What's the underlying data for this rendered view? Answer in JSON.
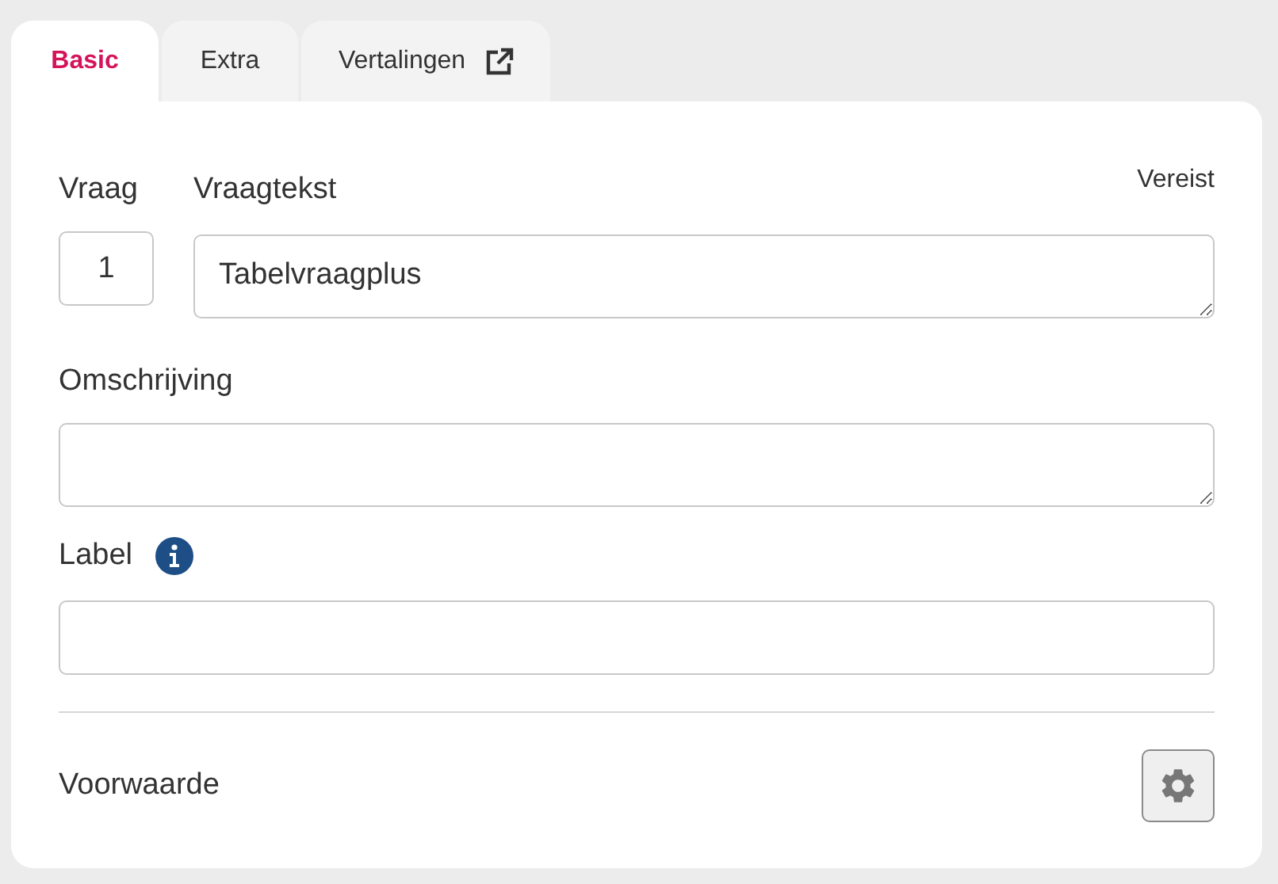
{
  "tabs": [
    {
      "label": "Basic",
      "selected": true,
      "external": false
    },
    {
      "label": "Extra",
      "selected": false,
      "external": false
    },
    {
      "label": "Vertalingen",
      "selected": false,
      "external": true
    }
  ],
  "question": {
    "number_label": "Vraag",
    "number_value": "1",
    "text_label": "Vraagtekst",
    "required_note": "Vereist",
    "text_value": "Tabelvraagplus"
  },
  "description": {
    "label": "Omschrijving"
  },
  "label_field": {
    "label": "Label",
    "info": true
  },
  "condition": {
    "label": "Voorwaarde"
  }
}
